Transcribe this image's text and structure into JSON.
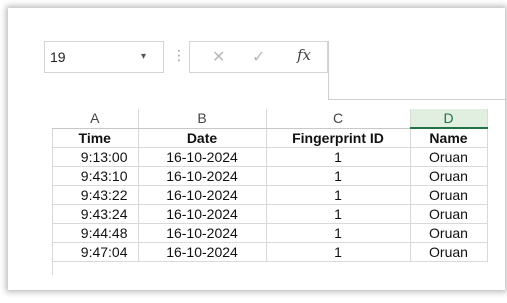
{
  "formula_bar": {
    "name_box_value": "19",
    "dropdown_glyph": "▾",
    "more_glyph": "⋮",
    "cancel_glyph": "✕",
    "enter_glyph": "✓",
    "fx_label": "fx"
  },
  "sheet": {
    "columns": [
      "A",
      "B",
      "C",
      "D"
    ],
    "selected_column": "D",
    "header_row": [
      "Time",
      "Date",
      "Fingerprint ID",
      "Name"
    ],
    "rows": [
      [
        "9:13:00",
        "16-10-2024",
        "1",
        "Oruan"
      ],
      [
        "9:43:10",
        "16-10-2024",
        "1",
        "Oruan"
      ],
      [
        "9:43:22",
        "16-10-2024",
        "1",
        "Oruan"
      ],
      [
        "9:43:24",
        "16-10-2024",
        "1",
        "Oruan"
      ],
      [
        "9:44:48",
        "16-10-2024",
        "1",
        "Oruan"
      ],
      [
        "9:47:04",
        "16-10-2024",
        "1",
        "Oruan"
      ]
    ]
  },
  "colors": {
    "accent": "#217346",
    "selected_header_bg": "#e1efe1",
    "gridline": "#d9d9d9"
  }
}
